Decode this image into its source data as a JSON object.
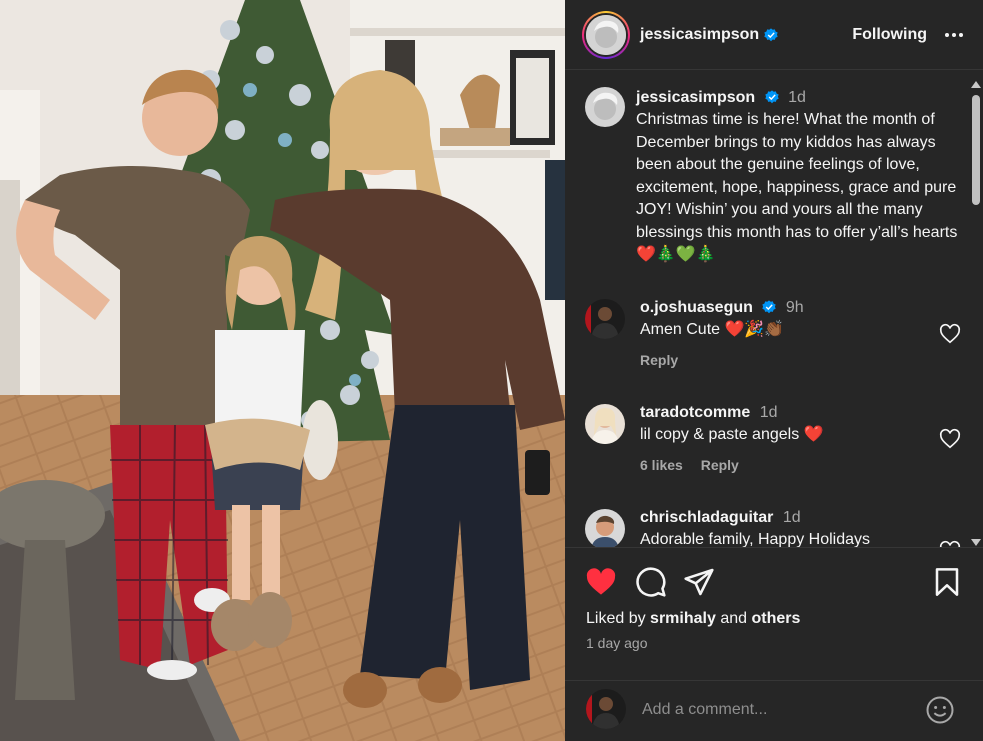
{
  "post": {
    "author": "jessicasimpson",
    "follow_status": "Following",
    "caption_time": "1d",
    "caption": "Christmas time is here! What the month of December brings to my kiddos has always been about the genuine feelings of love, excitement, hope, happiness, grace and pure JOY! Wishin’ you and yours all the many blessings this month has to offer y’all’s hearts ❤️🎄💚🎄"
  },
  "comments": [
    {
      "username": "o.joshuasegun",
      "verified": true,
      "time": "9h",
      "text": "Amen Cute ❤️🎉👏🏾",
      "likes": "",
      "reply": "Reply"
    },
    {
      "username": "taradotcomme",
      "verified": false,
      "time": "1d",
      "text": "lil copy & paste angels ❤️",
      "likes": "6 likes",
      "reply": "Reply"
    },
    {
      "username": "chrischladaguitar",
      "verified": false,
      "time": "1d",
      "text": "Adorable family, Happy Holidays",
      "likes": "",
      "reply": ""
    }
  ],
  "engagement": {
    "liked_by_prefix": "Liked by",
    "liked_by_user": "srmihaly",
    "liked_by_and": "and",
    "liked_by_others": "others",
    "posted_ago": "1 day ago",
    "liked": true
  },
  "add_comment": {
    "placeholder": "Add a comment..."
  },
  "icons": {
    "like": "heart-filled-icon",
    "comment": "speech-bubble-icon",
    "share": "paper-plane-icon",
    "save": "bookmark-icon",
    "more": "more-horizontal-icon",
    "emoji": "smiley-icon",
    "verified": "verified-badge-icon"
  },
  "colors": {
    "panel_bg": "#262626",
    "like_red": "#ff3040",
    "verified_blue": "#0095f6",
    "muted": "#a8a8a8"
  }
}
